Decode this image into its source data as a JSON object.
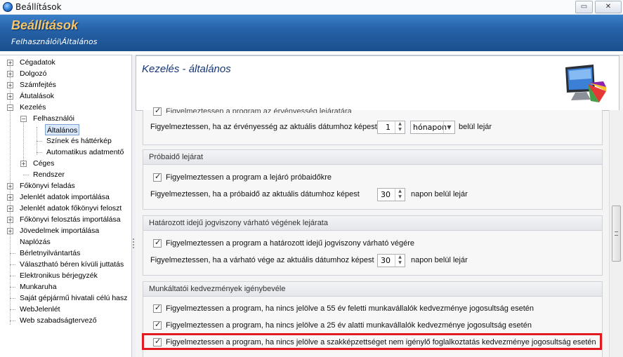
{
  "window": {
    "title": "Beállítások"
  },
  "header": {
    "title": "Beállítások",
    "subtitle": "Felhasználói\\Általános"
  },
  "tree": [
    "Cégadatok",
    "Dolgozó",
    "Számfejtés",
    "Átutalások",
    "Kezelés",
    "Felhasználói",
    "Általános",
    "Színek és háttérkép",
    "Automatikus adatmentő",
    "Céges",
    "Rendszer",
    "Főkönyvi feladás",
    "Jelenlét adatok importálása",
    "Jelenlét adatok főkönyvi feloszt",
    "Főkönyvi felosztás importálása",
    "Jövedelmek importálása",
    "Naplózás",
    "Bérletnyilvántartás",
    "Választható béren kívüli juttatás",
    "Elektronikus bérjegyzék",
    "Munkaruha",
    "Saját gépjármű hivatali célú hasz",
    "WebJelenlét",
    "Web szabadságtervező"
  ],
  "content": {
    "title": "Kezelés - általános",
    "top_partial": {
      "checkbox_label": "Figyelmeztessen a program az érvényesség lejáratára",
      "row_label": "Figyelmeztessen, ha az érvényesség az aktuális dátumhoz képest",
      "spin_value": "1",
      "unit": "hónapon",
      "suffix": "belül lejár"
    },
    "groups": [
      {
        "title": "Próbaidő lejárat",
        "checkbox_label": "Figyelmeztessen a program a lejáró próbaidőkre",
        "row_label": "Figyelmeztessen, ha a próbaidő az aktuális dátumhoz képest",
        "spin_value": "30",
        "suffix": "napon belül lejár"
      },
      {
        "title": "Határozott idejű jogviszony várható végének lejárata",
        "checkbox_label": "Figyelmeztessen a program a határozott idejű jogviszony várható végére",
        "row_label": "Figyelmeztessen, ha a várható vége az aktuális dátumhoz képest",
        "spin_value": "30",
        "suffix": "napon belül lejár"
      },
      {
        "title": "Munkáltatói kedvezmények igénybevéle",
        "checks": [
          "Figyelmeztessen a program, ha nincs jelölve a 55 év feletti munkavállalók kedvezménye jogosultság esetén",
          "Figyelmeztessen a program, ha nincs jelölve a 25 év alatti munkavállalók kedvezménye jogosultság esetén",
          "Figyelmeztessen a program, ha nincs jelölve a szakképzettséget nem igénylő foglalkoztatás kedvezménye jogosultság esetén"
        ]
      }
    ]
  },
  "colors": {
    "header_bg": "#2662a8",
    "header_title": "#f6c66a",
    "highlight": "#e21b22",
    "content_title": "#14367a"
  },
  "icons": [
    "app-globe-icon",
    "restore-icon",
    "close-icon",
    "monitor-palette-icon"
  ]
}
